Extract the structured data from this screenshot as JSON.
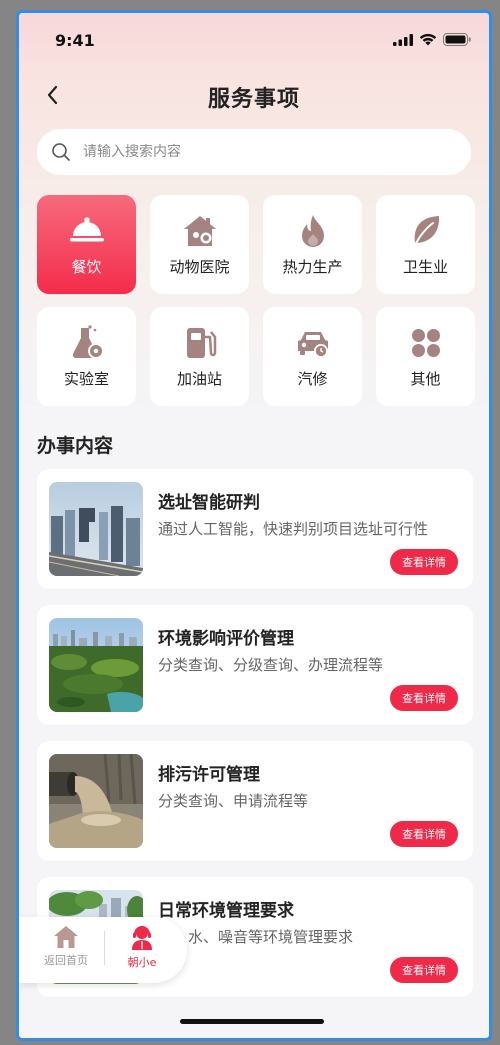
{
  "status": {
    "time": "9:41"
  },
  "header": {
    "title": "服务事项"
  },
  "search": {
    "placeholder": "请输入搜索内容"
  },
  "categories": [
    {
      "label": "餐饮",
      "icon": "cloche-icon",
      "active": true
    },
    {
      "label": "动物医院",
      "icon": "animal-hospital-icon",
      "active": false
    },
    {
      "label": "热力生产",
      "icon": "flame-icon",
      "active": false
    },
    {
      "label": "卫生业",
      "icon": "leaf-icon",
      "active": false
    },
    {
      "label": "实验室",
      "icon": "flask-gear-icon",
      "active": false
    },
    {
      "label": "加油站",
      "icon": "fuel-pump-icon",
      "active": false
    },
    {
      "label": "汽修",
      "icon": "car-repair-icon",
      "active": false
    },
    {
      "label": "其他",
      "icon": "grid-icon",
      "active": false
    }
  ],
  "section": {
    "title": "办事内容"
  },
  "items": [
    {
      "title": "选址智能研判",
      "desc": "通过人工智能，快速判别项目选址可行性",
      "button": "查看详情"
    },
    {
      "title": "环境影响评价管理",
      "desc": "分类查询、分级查询、办理流程等",
      "button": "查看详情"
    },
    {
      "title": "排污许可管理",
      "desc": "分类查询、申请流程等",
      "button": "查看详情"
    },
    {
      "title": "日常环境管理要求",
      "desc": "气、水、噪音等环境管理要求",
      "button": "查看详情"
    }
  ],
  "floating": {
    "home_label": "返回首页",
    "assistant_label": "朝小e"
  },
  "colors": {
    "accent": "#ef2948",
    "icon": "#a58380",
    "muted": "#b99896"
  }
}
